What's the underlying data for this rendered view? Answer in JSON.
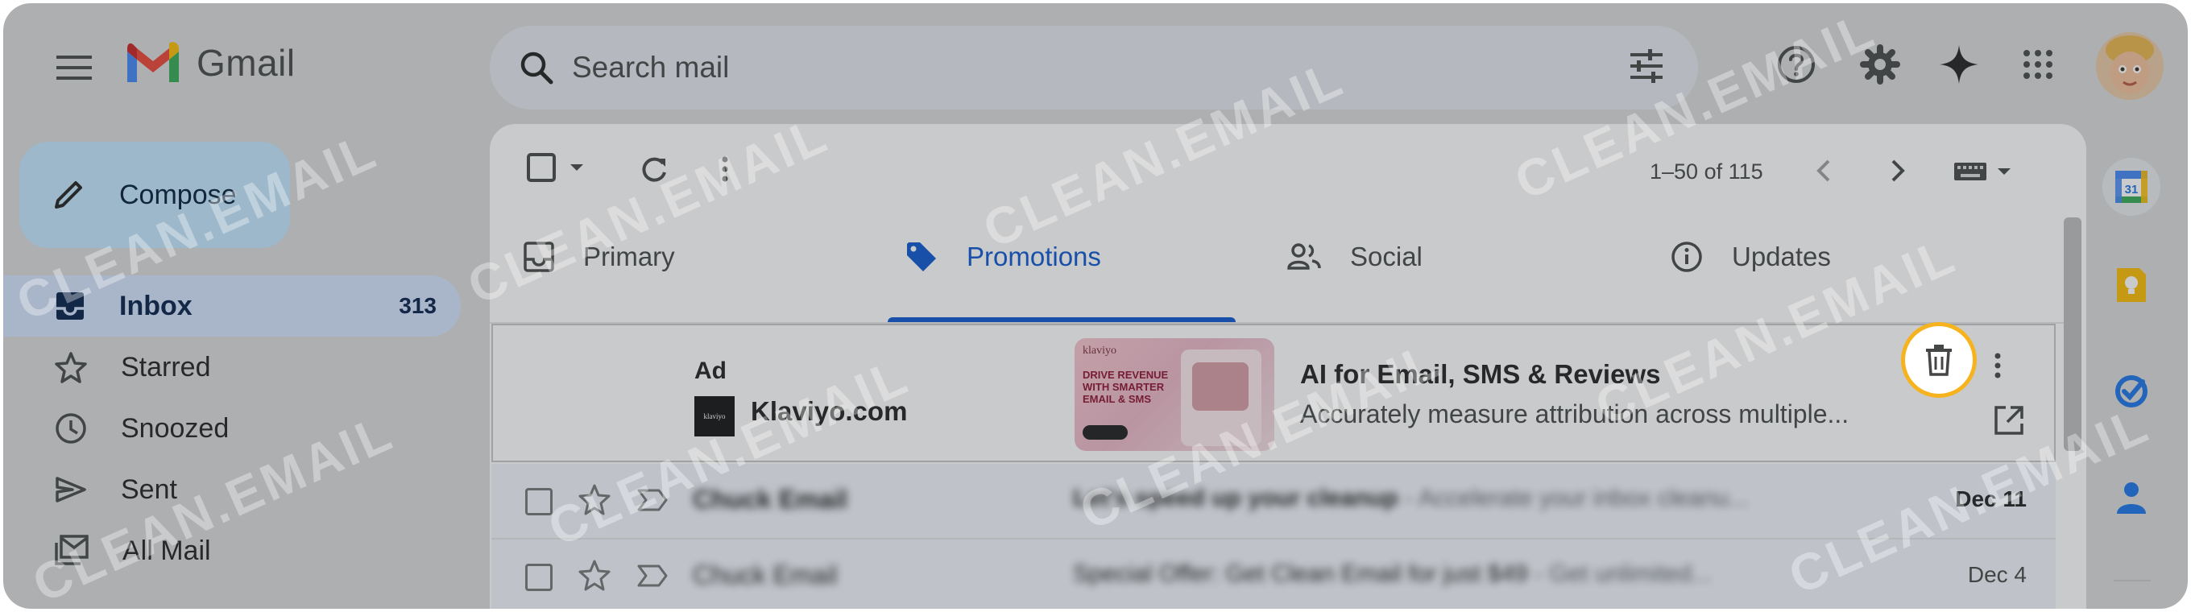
{
  "app": {
    "name": "Gmail"
  },
  "search": {
    "placeholder": "Search mail"
  },
  "compose": {
    "label": "Compose"
  },
  "nav": {
    "items": [
      {
        "label": "Inbox",
        "count": "313"
      },
      {
        "label": "Starred"
      },
      {
        "label": "Snoozed"
      },
      {
        "label": "Sent"
      },
      {
        "label": "All Mail"
      }
    ]
  },
  "toolbar": {
    "pagination": "1–50 of 115"
  },
  "tabs": [
    {
      "label": "Primary"
    },
    {
      "label": "Promotions"
    },
    {
      "label": "Social"
    },
    {
      "label": "Updates"
    }
  ],
  "ad": {
    "tag": "Ad",
    "sender": "Klaviyo.com",
    "subject": "AI for Email, SMS & Reviews",
    "snippet": "Accurately measure attribution across multiple...",
    "thumb_brand": "klaviyo",
    "thumb_headline": "DRIVE REVENUE WITH SMARTER EMAIL & SMS",
    "logo_text": "klaviyo"
  },
  "rows": [
    {
      "sender": "Chuck Email",
      "subject": "Let's speed up your cleanup",
      "snippet": " - Accelerate your inbox cleanu...",
      "date": "Dec 11",
      "unread": true
    },
    {
      "sender": "Chuck Email",
      "subject": "Special Offer: Get Clean Email for just $49",
      "snippet": " - Get unlimited...",
      "date": "Dec 4",
      "unread": false
    }
  ],
  "rail": {
    "calendar_day": "31"
  },
  "watermark": "CLEAN.EMAIL",
  "colors": {
    "accent": "#0b57d0",
    "highlight_ring": "#f6b31e",
    "compose_bg": "#c2e7ff",
    "active_nav_bg": "#d3e3fd"
  }
}
